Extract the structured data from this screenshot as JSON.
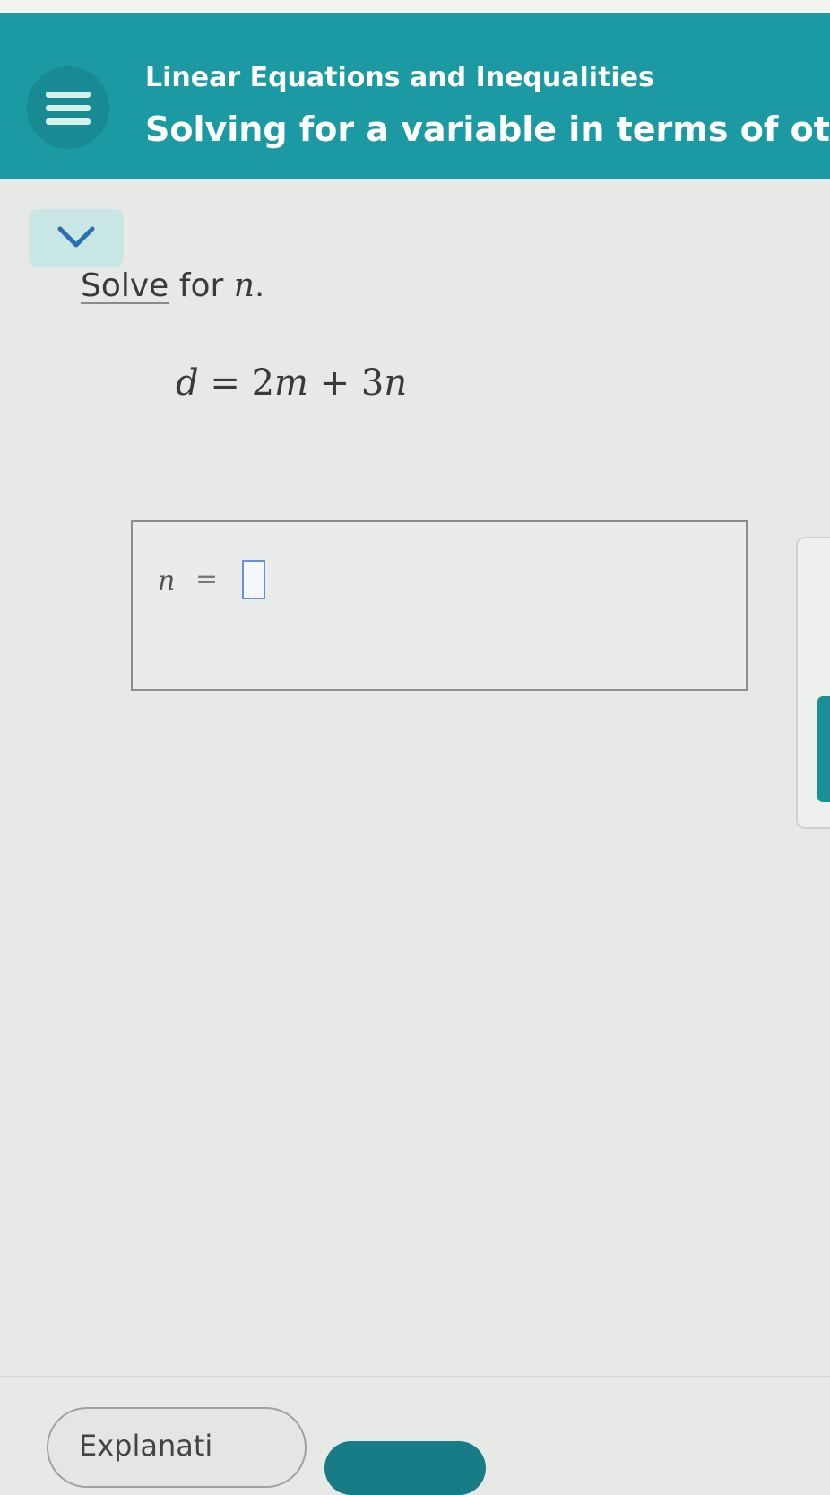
{
  "header": {
    "title": "Linear Equations and Inequalities",
    "subtitle": "Solving for a variable in terms of other varia",
    "menu_icon": "hamburger-icon",
    "color": "#1c9aa3"
  },
  "collapse": {
    "icon": "chevron-down-icon"
  },
  "problem": {
    "prompt_solve": "Solve",
    "prompt_for": " for ",
    "prompt_var": "n",
    "prompt_end": ".",
    "equation": {
      "lhs": "d",
      "equals": " = ",
      "coef1": "2",
      "var1": "m",
      "plus": " + ",
      "coef2": "3",
      "var2": "n"
    }
  },
  "answer": {
    "variable": "n",
    "equals": "=",
    "value": ""
  },
  "footer": {
    "explanation_label": "Explanati",
    "accent": "#177c86"
  }
}
